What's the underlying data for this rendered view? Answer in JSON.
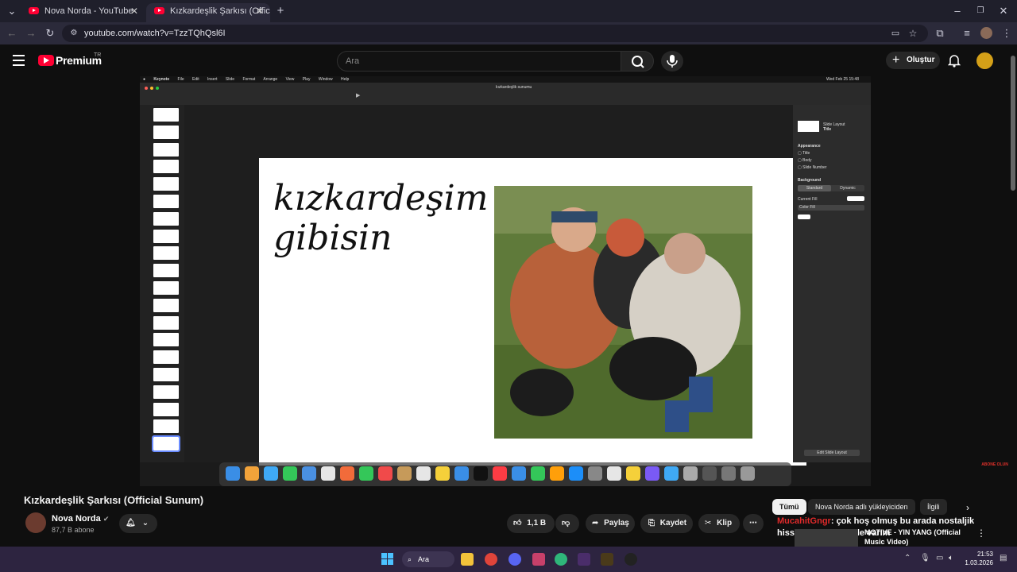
{
  "browser": {
    "tabs": [
      {
        "title": "Nova Norda - YouTube"
      },
      {
        "title": "Kızkardeşlik Şarkısı (Official Sun"
      }
    ],
    "url": "youtube.com/watch?v=TzzTQhQsl6I"
  },
  "youtube": {
    "logo_text": "Premium",
    "region_badge": "TR",
    "search_placeholder": "Ara",
    "create_label": "Oluştur"
  },
  "video": {
    "app_menu": [
      "Keynote",
      "File",
      "Edit",
      "Insert",
      "Slide",
      "Format",
      "Arrange",
      "View",
      "Play",
      "Window",
      "Help"
    ],
    "document_title": "kızkardeşlik sunumu",
    "clock": "Wed Feb 25 15:48",
    "slide_text": "kızkardeşim\ngibisin",
    "inspector": {
      "slide_layout_label": "Slide Layout",
      "slide_layout_value": "Title",
      "appearance": "Appearance",
      "options": [
        "Title",
        "Body",
        "Slide Number"
      ],
      "background": "Background",
      "bg_tabs": [
        "Standard",
        "Dynamic"
      ],
      "current_fill": "Current Fill",
      "fill_type": "Color Fill",
      "edit_layout": "Edit Slide Layout"
    },
    "watermark": "ABONE OLUN"
  },
  "watch": {
    "title": "Kızkardeşlik Şarkısı (Official Sunum)",
    "channel_name": "Nova Norda",
    "subscribers": "87,7 B abone",
    "likes": "1,1 B",
    "share": "Paylaş",
    "save": "Kaydet",
    "clip": "Klip"
  },
  "sidebar": {
    "chips": [
      "Tümü",
      "Nova Norda adlı yükleyiciden",
      "İlgili"
    ],
    "comment_user": "MucahitGngr",
    "comment_text": ": çok hoş olmuş bu arada nostaljik hissettiren her şeyde varım",
    "next_video_title": "MOTIVE - YIN YANG (Official Music Video)"
  },
  "taskbar": {
    "search_label": "Ara",
    "time": "21:53",
    "date": "1.03.2026"
  }
}
